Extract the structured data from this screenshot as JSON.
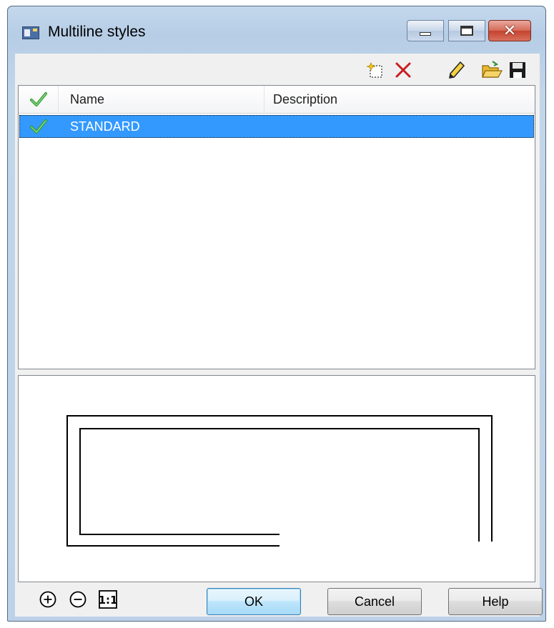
{
  "window": {
    "title": "Multiline styles",
    "icons": {
      "app": "app-window-icon",
      "minimize": "minimize-icon",
      "maximize": "maximize-icon",
      "close": "close-icon"
    },
    "close_color": "#c4422f"
  },
  "toolbar": {
    "icons": [
      "new-style-icon",
      "delete-icon",
      "edit-pencil-icon",
      "open-folder-icon",
      "save-disk-icon"
    ],
    "delete_color": "#c81e1e"
  },
  "list": {
    "columns": {
      "check": "check-icon",
      "name": "Name",
      "description": "Description"
    },
    "rows": [
      {
        "checked": true,
        "name": "STANDARD",
        "description": "",
        "selected": true
      }
    ],
    "selection_color": "#3399ff",
    "check_color": "#2e9e2e"
  },
  "preview": {
    "description": "multiline preview"
  },
  "footer": {
    "zoom_icons": [
      "zoom-in-icon",
      "zoom-out-icon",
      "zoom-1to1-icon"
    ],
    "zoom_1to1_label": "1:1",
    "ok_label": "OK",
    "cancel_label": "Cancel",
    "help_label": "Help"
  }
}
